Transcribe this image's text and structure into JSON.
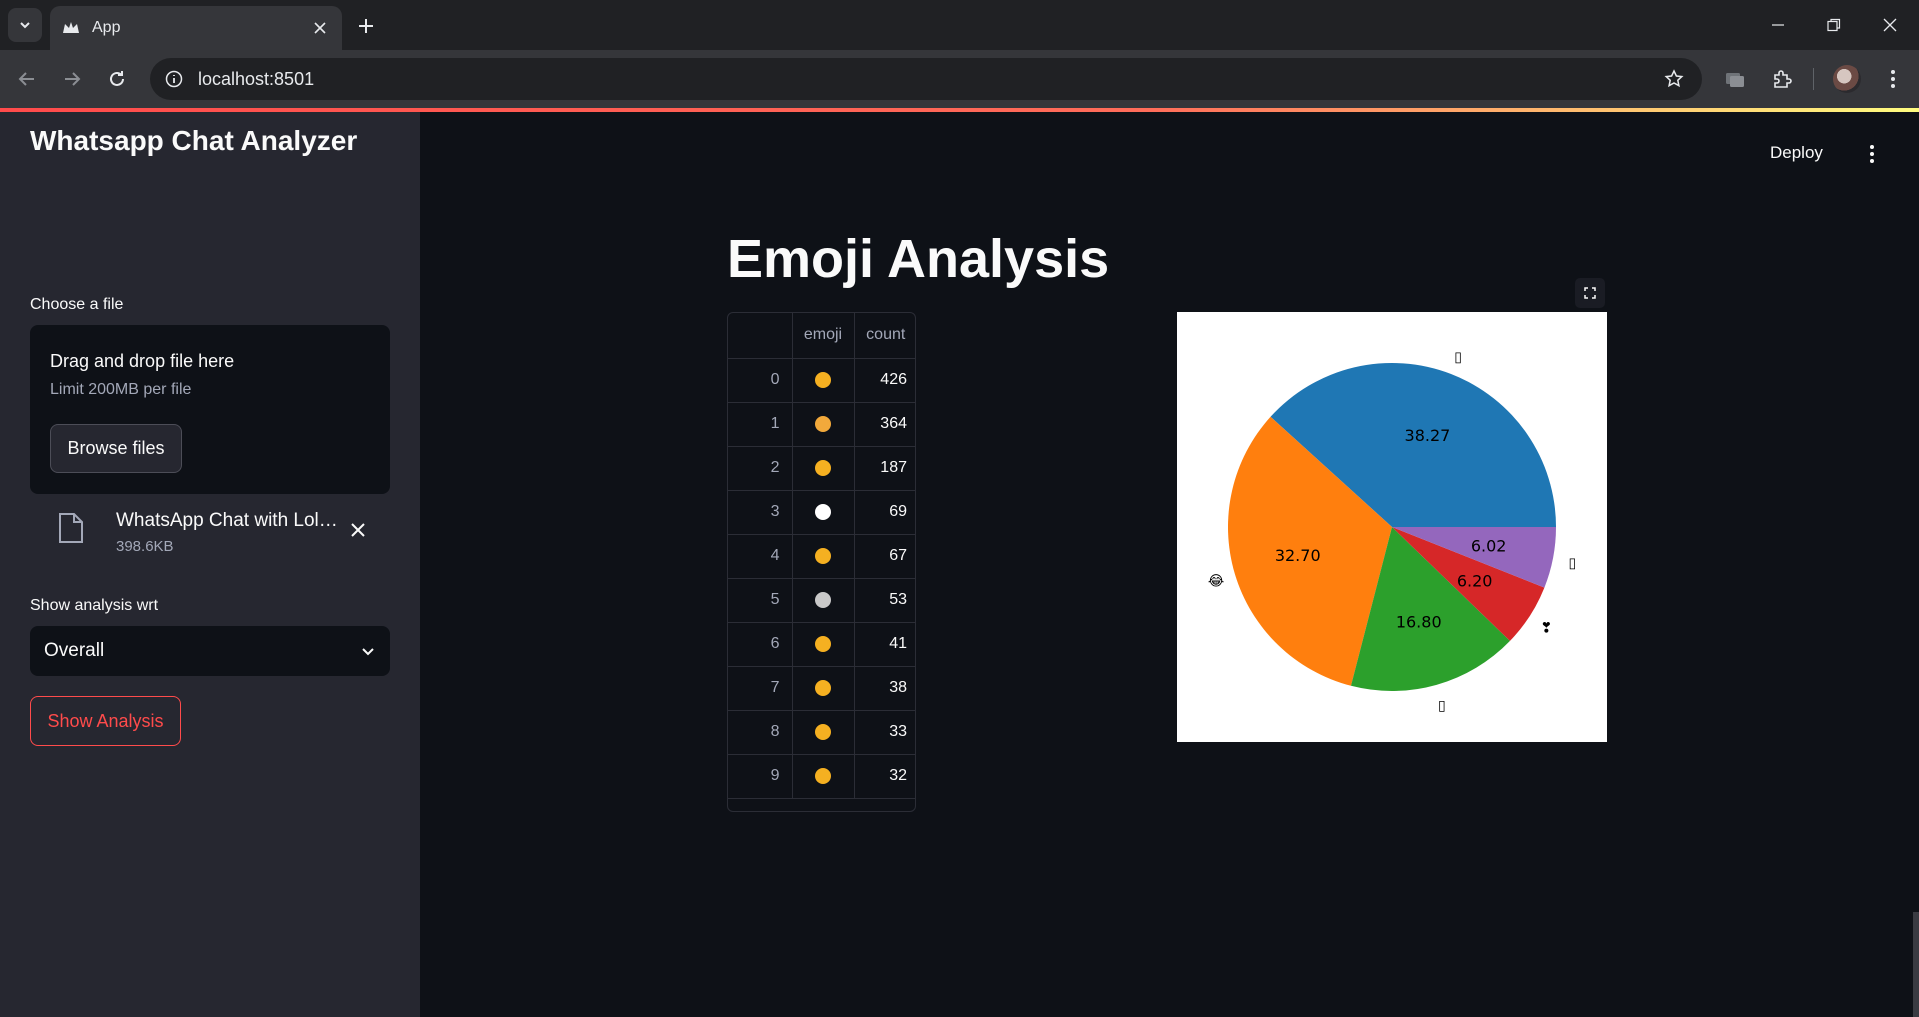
{
  "browser": {
    "tab_title": "App",
    "url": "localhost:8501"
  },
  "sidebar": {
    "title": "Whatsapp Chat Analyzer",
    "file_label": "Choose a file",
    "dropzone_title": "Drag and drop file here",
    "dropzone_limit": "Limit 200MB per file",
    "browse_label": "Browse files",
    "file_name": "WhatsApp Chat with Lolo…",
    "file_size": "398.6KB",
    "analysis_wrt_label": "Show analysis wrt",
    "select_value": "Overall",
    "show_analysis_label": "Show Analysis"
  },
  "header": {
    "deploy_label": "Deploy"
  },
  "main": {
    "heading": "Emoji Analysis",
    "table": {
      "columns": [
        "",
        "emoji",
        "count"
      ],
      "rows": [
        {
          "idx": "0",
          "emoji": "🤣",
          "count": "426",
          "color": "#f5b021"
        },
        {
          "idx": "1",
          "emoji": "😂",
          "count": "364",
          "color": "#f2a93b"
        },
        {
          "idx": "2",
          "emoji": "😬",
          "count": "187",
          "color": "#f5b021"
        },
        {
          "idx": "3",
          "emoji": "❣",
          "count": "69",
          "color": "#ffffff"
        },
        {
          "idx": "4",
          "emoji": "😘",
          "count": "67",
          "color": "#f5b021"
        },
        {
          "idx": "5",
          "emoji": "🏻",
          "count": "53",
          "color": "#c9c9c9"
        },
        {
          "idx": "6",
          "emoji": "😭",
          "count": "41",
          "color": "#f5b021"
        },
        {
          "idx": "7",
          "emoji": "🥺",
          "count": "38",
          "color": "#f5b021"
        },
        {
          "idx": "8",
          "emoji": "🫠",
          "count": "33",
          "color": "#f5b021"
        },
        {
          "idx": "9",
          "emoji": "🙃",
          "count": "32",
          "color": "#f5b021"
        }
      ]
    }
  },
  "chart_data": {
    "type": "pie",
    "labels": [
      "▯",
      "😂",
      "▯",
      "❣",
      "▯"
    ],
    "values": [
      38.27,
      32.7,
      16.8,
      6.2,
      6.02
    ],
    "value_labels": [
      "38.27",
      "32.70",
      "16.80",
      "6.20",
      "6.02"
    ],
    "colors": [
      "#1f77b4",
      "#ff7f0e",
      "#2ca02c",
      "#d62728",
      "#9467bd"
    ],
    "title": ""
  }
}
